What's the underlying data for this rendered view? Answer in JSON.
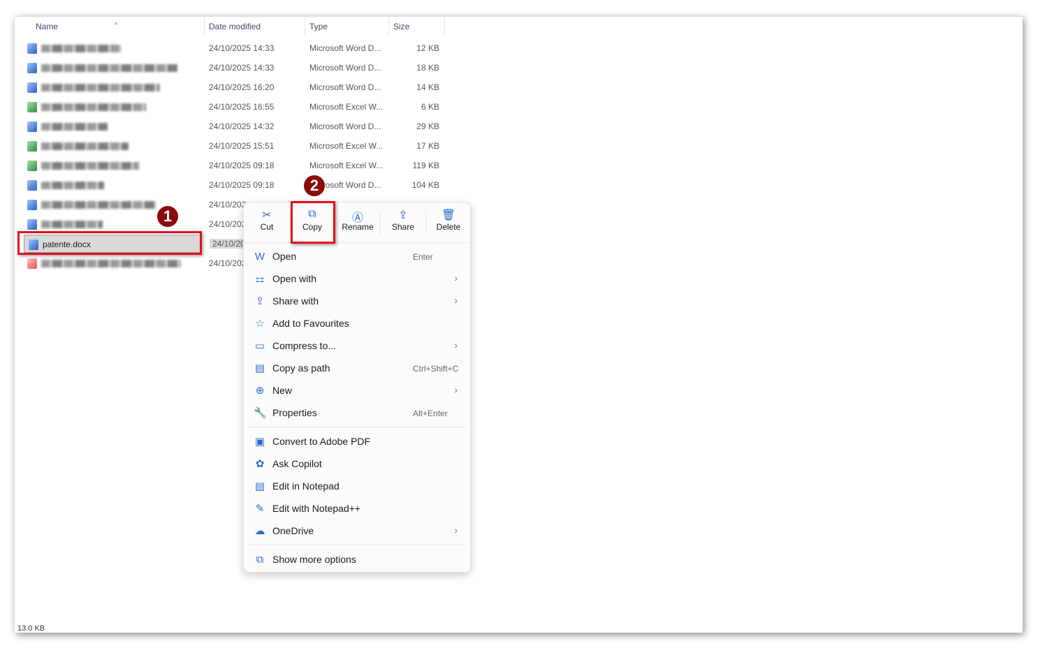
{
  "columns": {
    "name": "Name",
    "date": "Date modified",
    "type": "Type",
    "size": "Size"
  },
  "files": [
    {
      "date": "24/10/2025 14:33",
      "type": "Microsoft Word D...",
      "size": "12 KB",
      "kind": "word"
    },
    {
      "date": "24/10/2025 14:33",
      "type": "Microsoft Word D...",
      "size": "18 KB",
      "kind": "word"
    },
    {
      "date": "24/10/2025 16:20",
      "type": "Microsoft Word D...",
      "size": "14 KB",
      "kind": "word"
    },
    {
      "date": "24/10/2025 16:55",
      "type": "Microsoft Excel W...",
      "size": "6 KB",
      "kind": "excel"
    },
    {
      "date": "24/10/2025 14:32",
      "type": "Microsoft Word D...",
      "size": "29 KB",
      "kind": "word"
    },
    {
      "date": "24/10/2025 15:51",
      "type": "Microsoft Excel W...",
      "size": "17 KB",
      "kind": "excel"
    },
    {
      "date": "24/10/2025 09:18",
      "type": "Microsoft Excel W...",
      "size": "119 KB",
      "kind": "excel"
    },
    {
      "date": "24/10/2025 09:18",
      "type": "Microsoft Word D...",
      "size": "104 KB",
      "kind": "word"
    },
    {
      "date": "24/10/202",
      "kind": "word"
    },
    {
      "date": "24/10/202",
      "kind": "word"
    },
    {
      "name": "patente.docx",
      "date": "24/10/202",
      "kind": "word",
      "selected": true
    },
    {
      "date": "24/10/202",
      "kind": "pdf"
    }
  ],
  "status": {
    "size": "13.0 KB"
  },
  "context_menu": {
    "toolbar": [
      {
        "label": "Cut",
        "icon": "scissors-icon",
        "glyph": "✂"
      },
      {
        "label": "Copy",
        "icon": "copy-icon",
        "glyph": "⧉"
      },
      {
        "label": "Rename",
        "icon": "rename-icon",
        "glyph": "Ⓐ"
      },
      {
        "label": "Share",
        "icon": "share-icon",
        "glyph": "⇪"
      },
      {
        "label": "Delete",
        "icon": "trash-icon",
        "glyph": "🗑"
      }
    ],
    "items": [
      {
        "label": "Open",
        "shortcut": "Enter",
        "icon": "word-icon",
        "glyph": "W"
      },
      {
        "label": "Open with",
        "submenu": true,
        "icon": "open-with-icon",
        "glyph": "⚏"
      },
      {
        "label": "Share with",
        "submenu": true,
        "icon": "share-with-icon",
        "glyph": "⇪"
      },
      {
        "label": "Add to Favourites",
        "icon": "star-icon",
        "glyph": "☆"
      },
      {
        "label": "Compress to...",
        "submenu": true,
        "icon": "zip-folder-icon",
        "glyph": "▭"
      },
      {
        "label": "Copy as path",
        "shortcut": "Ctrl+Shift+C",
        "icon": "path-icon",
        "glyph": "▤"
      },
      {
        "label": "New",
        "submenu": true,
        "icon": "plus-circle-icon",
        "glyph": "⊕"
      },
      {
        "label": "Properties",
        "shortcut": "Alt+Enter",
        "icon": "wrench-icon",
        "glyph": "🔧"
      },
      {
        "label": "Convert to Adobe PDF",
        "icon": "adobe-pdf-icon",
        "glyph": "▣"
      },
      {
        "label": "Ask Copilot",
        "icon": "copilot-icon",
        "glyph": "✿"
      },
      {
        "label": "Edit in Notepad",
        "icon": "notepad-icon",
        "glyph": "▤"
      },
      {
        "label": "Edit with Notepad++",
        "icon": "notepadpp-icon",
        "glyph": "✎"
      },
      {
        "label": "OneDrive",
        "submenu": true,
        "icon": "onedrive-icon",
        "glyph": "☁"
      },
      {
        "label": "Show more options",
        "icon": "more-options-icon",
        "glyph": "⧉"
      }
    ],
    "chevron": "›"
  },
  "annotations": [
    {
      "label": "1"
    },
    {
      "label": "2"
    }
  ],
  "colors": {
    "highlight": "#e3101a",
    "badge": "#8b0b0b",
    "accent": "#2a6ac8"
  }
}
